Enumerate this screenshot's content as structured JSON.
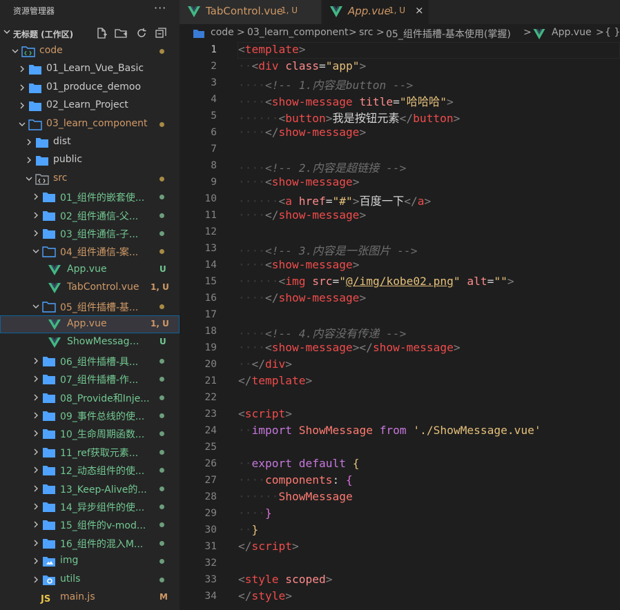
{
  "sidebar": {
    "title": "资源管理器",
    "more": "···",
    "workspace": "无标题 (工作区)"
  },
  "tree": [
    {
      "label": "code",
      "kind": "root-folder",
      "expanded": true,
      "status": "modified"
    },
    {
      "label": "01_Learn_Vue_Basic",
      "kind": "folder",
      "expanded": false,
      "status": "none"
    },
    {
      "label": "01_produce_demoo",
      "kind": "folder",
      "expanded": false,
      "status": "none"
    },
    {
      "label": "02_Learn_Project",
      "kind": "folder",
      "expanded": false,
      "status": "none"
    },
    {
      "label": "03_learn_component",
      "kind": "folder",
      "expanded": true,
      "status": "modified"
    },
    {
      "label": "dist",
      "kind": "folder",
      "expanded": false,
      "status": "none"
    },
    {
      "label": "public",
      "kind": "folder",
      "expanded": false,
      "status": "none"
    },
    {
      "label": "src",
      "kind": "src-folder",
      "expanded": true,
      "status": "modified"
    },
    {
      "label": "01_组件的嵌套使...",
      "kind": "folder",
      "expanded": false,
      "status": "untracked"
    },
    {
      "label": "02_组件通信-父...",
      "kind": "folder",
      "expanded": false,
      "status": "untracked"
    },
    {
      "label": "03_组件通信-子...",
      "kind": "folder",
      "expanded": false,
      "status": "untracked"
    },
    {
      "label": "04_组件通信-案...",
      "kind": "folder",
      "expanded": true,
      "status": "modified"
    },
    {
      "label": "App.vue",
      "kind": "vue",
      "badge": "U",
      "status": "untracked"
    },
    {
      "label": "TabControl.vue",
      "kind": "vue",
      "badge": "1, U",
      "status": "modified"
    },
    {
      "label": "05_组件插槽-基...",
      "kind": "folder",
      "expanded": true,
      "status": "modified"
    },
    {
      "label": "App.vue",
      "kind": "vue",
      "badge": "1, U",
      "status": "selected"
    },
    {
      "label": "ShowMessage.v...",
      "kind": "vue",
      "badge": "U",
      "status": "untracked"
    },
    {
      "label": "06_组件插槽-具...",
      "kind": "folder",
      "expanded": false,
      "status": "untracked"
    },
    {
      "label": "07_组件插槽-作...",
      "kind": "folder",
      "expanded": false,
      "status": "untracked"
    },
    {
      "label": "08_Provide和Inje...",
      "kind": "folder",
      "expanded": false,
      "status": "untracked"
    },
    {
      "label": "09_事件总线的使...",
      "kind": "folder",
      "expanded": false,
      "status": "untracked"
    },
    {
      "label": "10_生命周期函数...",
      "kind": "folder",
      "expanded": false,
      "status": "untracked"
    },
    {
      "label": "11_ref获取元素...",
      "kind": "folder",
      "expanded": false,
      "status": "untracked"
    },
    {
      "label": "12_动态组件的使...",
      "kind": "folder",
      "expanded": false,
      "status": "untracked"
    },
    {
      "label": "13_Keep-Alive的...",
      "kind": "folder",
      "expanded": false,
      "status": "untracked"
    },
    {
      "label": "14_异步组件的使...",
      "kind": "folder",
      "expanded": false,
      "status": "untracked"
    },
    {
      "label": "15_组件的v-mod...",
      "kind": "folder",
      "expanded": false,
      "status": "untracked"
    },
    {
      "label": "16_组件的混入M...",
      "kind": "folder",
      "expanded": false,
      "status": "untracked"
    },
    {
      "label": "img",
      "kind": "img-folder",
      "expanded": false,
      "status": "untracked"
    },
    {
      "label": "utils",
      "kind": "utils-folder",
      "expanded": false,
      "status": "untracked"
    },
    {
      "label": "main.js",
      "kind": "js",
      "badge": "M",
      "status": "modified-file"
    }
  ],
  "tabs": [
    {
      "label": "TabControl.vue",
      "badge": "1, U",
      "active": false
    },
    {
      "label": "App.vue",
      "badge": "1, U",
      "active": true,
      "close": "×"
    }
  ],
  "breadcrumbs": [
    "code",
    ">",
    "03_learn_component",
    ">",
    "src",
    ">",
    "05_组件插槽-基本使用(掌握)",
    ">",
    "App.vue",
    ">",
    "{ }"
  ],
  "code": {
    "active_line": 1,
    "lines": [
      [
        [
          "t-br",
          "<"
        ],
        [
          "t-tag",
          "template"
        ],
        [
          "t-br",
          ">"
        ]
      ],
      [
        [
          "ws",
          "  "
        ],
        [
          "t-br",
          "<"
        ],
        [
          "t-tag",
          "div "
        ],
        [
          "t-attr",
          "class"
        ],
        [
          "t-txt",
          "="
        ],
        [
          "t-str",
          "\"app\""
        ],
        [
          "t-br",
          ">"
        ]
      ],
      [
        [
          "ws",
          "    "
        ],
        [
          "t-com",
          "<!-- 1.内容是button -->"
        ]
      ],
      [
        [
          "ws",
          "    "
        ],
        [
          "t-br",
          "<"
        ],
        [
          "t-tag",
          "show-message "
        ],
        [
          "t-attr",
          "title"
        ],
        [
          "t-txt",
          "="
        ],
        [
          "t-str",
          "\"哈哈哈\""
        ],
        [
          "t-br",
          ">"
        ]
      ],
      [
        [
          "ws",
          "      "
        ],
        [
          "t-br",
          "<"
        ],
        [
          "t-tag",
          "button"
        ],
        [
          "t-br",
          ">"
        ],
        [
          "t-txt",
          "我是按钮元素"
        ],
        [
          "t-br",
          "</"
        ],
        [
          "t-tag",
          "button"
        ],
        [
          "t-br",
          ">"
        ]
      ],
      [
        [
          "ws",
          "    "
        ],
        [
          "t-br",
          "</"
        ],
        [
          "t-tag",
          "show-message"
        ],
        [
          "t-br",
          ">"
        ]
      ],
      [],
      [
        [
          "ws",
          "    "
        ],
        [
          "t-com",
          "<!-- 2.内容是超链接 -->"
        ]
      ],
      [
        [
          "ws",
          "    "
        ],
        [
          "t-br",
          "<"
        ],
        [
          "t-tag",
          "show-message"
        ],
        [
          "t-br",
          ">"
        ]
      ],
      [
        [
          "ws",
          "      "
        ],
        [
          "t-br",
          "<"
        ],
        [
          "t-tag",
          "a "
        ],
        [
          "t-attr",
          "href"
        ],
        [
          "t-txt",
          "="
        ],
        [
          "t-str",
          "\"#\""
        ],
        [
          "t-br",
          ">"
        ],
        [
          "t-txt",
          "百度一下"
        ],
        [
          "t-br",
          "</"
        ],
        [
          "t-tag",
          "a"
        ],
        [
          "t-br",
          ">"
        ]
      ],
      [
        [
          "ws",
          "    "
        ],
        [
          "t-br",
          "</"
        ],
        [
          "t-tag",
          "show-message"
        ],
        [
          "t-br",
          ">"
        ]
      ],
      [],
      [
        [
          "ws",
          "    "
        ],
        [
          "t-com",
          "<!-- 3.内容是一张图片 -->"
        ]
      ],
      [
        [
          "ws",
          "    "
        ],
        [
          "t-br",
          "<"
        ],
        [
          "t-tag",
          "show-message"
        ],
        [
          "t-br",
          ">"
        ]
      ],
      [
        [
          "ws",
          "      "
        ],
        [
          "t-br",
          "<"
        ],
        [
          "t-tag",
          "img "
        ],
        [
          "t-attr",
          "src"
        ],
        [
          "t-txt",
          "="
        ],
        [
          "t-str",
          "\""
        ],
        [
          "t-str t-und",
          "@/img/kobe02.png"
        ],
        [
          "t-str",
          "\""
        ],
        [
          "t-txt",
          " "
        ],
        [
          "t-attr",
          "alt"
        ],
        [
          "t-txt",
          "="
        ],
        [
          "t-str",
          "\"\""
        ],
        [
          "t-br",
          ">"
        ]
      ],
      [
        [
          "ws",
          "    "
        ],
        [
          "t-br",
          "</"
        ],
        [
          "t-tag",
          "show-message"
        ],
        [
          "t-br",
          ">"
        ]
      ],
      [],
      [
        [
          "ws",
          "    "
        ],
        [
          "t-com",
          "<!-- 4.内容没有传递 -->"
        ]
      ],
      [
        [
          "ws",
          "    "
        ],
        [
          "t-br",
          "<"
        ],
        [
          "t-tag",
          "show-message"
        ],
        [
          "t-br",
          "></"
        ],
        [
          "t-tag",
          "show-message"
        ],
        [
          "t-br",
          ">"
        ]
      ],
      [
        [
          "ws",
          "  "
        ],
        [
          "t-br",
          "</"
        ],
        [
          "t-tag",
          "div"
        ],
        [
          "t-br",
          ">"
        ]
      ],
      [
        [
          "t-br",
          "</"
        ],
        [
          "t-tag",
          "template"
        ],
        [
          "t-br",
          ">"
        ]
      ],
      [],
      [
        [
          "t-br",
          "<"
        ],
        [
          "t-tag",
          "script"
        ],
        [
          "t-br",
          ">"
        ]
      ],
      [
        [
          "ws",
          "  "
        ],
        [
          "t-kw",
          "import "
        ],
        [
          "t-fn",
          "ShowMessage "
        ],
        [
          "t-kw",
          "from "
        ],
        [
          "t-str",
          "'./ShowMessage.vue'"
        ]
      ],
      [],
      [
        [
          "ws",
          "  "
        ],
        [
          "t-kw",
          "export default "
        ],
        [
          "t-brace",
          "{"
        ]
      ],
      [
        [
          "ws",
          "    "
        ],
        [
          "t-fn",
          "components"
        ],
        [
          "t-txt",
          ": "
        ],
        [
          "t-brace2",
          "{"
        ]
      ],
      [
        [
          "ws",
          "      "
        ],
        [
          "t-fn",
          "ShowMessage"
        ]
      ],
      [
        [
          "ws",
          "    "
        ],
        [
          "t-brace2",
          "}"
        ]
      ],
      [
        [
          "ws",
          "  "
        ],
        [
          "t-brace",
          "}"
        ]
      ],
      [
        [
          "t-br",
          "</"
        ],
        [
          "t-tag",
          "script"
        ],
        [
          "t-br",
          ">"
        ]
      ],
      [],
      [
        [
          "t-br",
          "<"
        ],
        [
          "t-tag",
          "style "
        ],
        [
          "t-attr",
          "scoped"
        ],
        [
          "t-br",
          ">"
        ]
      ],
      [
        [
          "t-br",
          "</"
        ],
        [
          "t-tag",
          "style"
        ],
        [
          "t-br",
          ">"
        ]
      ]
    ]
  },
  "colors": {
    "modified": "#d19a66",
    "untracked": "#73c991",
    "vue_icon": "#41b883",
    "folder": "#4fa3ff",
    "selection_border": "#0e639c"
  }
}
